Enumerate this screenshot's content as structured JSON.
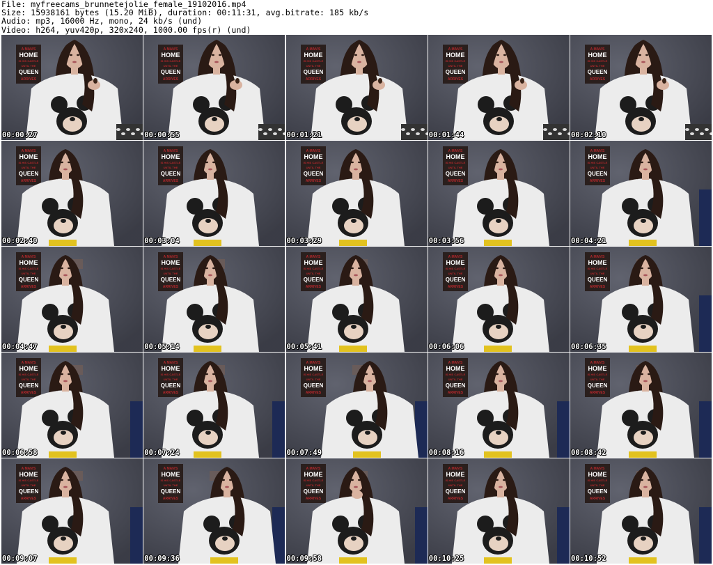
{
  "header": {
    "lines": [
      "File: myfreecams_brunnetejolie_female_19102016.mp4",
      "Size: 15938161 bytes (15.20 MiB), duration: 00:11:31, avg.bitrate: 185 kb/s",
      "Audio: mp3, 16000 Hz, mono, 24 kb/s (und)",
      "Video: h264, yuv420p, 320x240, 1000.00 fps(r) (und)"
    ]
  },
  "thumbnails": [
    {
      "timestamp": "00:00:27",
      "framing": "close",
      "pose": "holding-item"
    },
    {
      "timestamp": "00:00:55",
      "framing": "close",
      "pose": "holding-item"
    },
    {
      "timestamp": "00:01:21",
      "framing": "close",
      "pose": "holding-item"
    },
    {
      "timestamp": "00:01:44",
      "framing": "close",
      "pose": "holding-item"
    },
    {
      "timestamp": "00:02:10",
      "framing": "close",
      "pose": "holding-item"
    },
    {
      "timestamp": "00:02:40",
      "framing": "mid",
      "pose": "seated"
    },
    {
      "timestamp": "00:03:04",
      "framing": "mid",
      "pose": "seated"
    },
    {
      "timestamp": "00:03:29",
      "framing": "mid",
      "pose": "seated"
    },
    {
      "timestamp": "00:03:56",
      "framing": "mid",
      "pose": "seated"
    },
    {
      "timestamp": "00:04:21",
      "framing": "mid",
      "pose": "seated"
    },
    {
      "timestamp": "00:04:47",
      "framing": "mid",
      "pose": "seated"
    },
    {
      "timestamp": "00:05:14",
      "framing": "mid",
      "pose": "seated"
    },
    {
      "timestamp": "00:05:41",
      "framing": "mid",
      "pose": "seated"
    },
    {
      "timestamp": "00:06:06",
      "framing": "mid",
      "pose": "seated"
    },
    {
      "timestamp": "00:06:35",
      "framing": "mid",
      "pose": "seated"
    },
    {
      "timestamp": "00:06:58",
      "framing": "mid",
      "pose": "seated"
    },
    {
      "timestamp": "00:07:24",
      "framing": "mid",
      "pose": "seated"
    },
    {
      "timestamp": "00:07:49",
      "framing": "mid",
      "pose": "leaning"
    },
    {
      "timestamp": "00:08:16",
      "framing": "mid",
      "pose": "seated"
    },
    {
      "timestamp": "00:08:42",
      "framing": "mid",
      "pose": "seated"
    },
    {
      "timestamp": "00:09:07",
      "framing": "mid",
      "pose": "seated"
    },
    {
      "timestamp": "00:09:36",
      "framing": "mid",
      "pose": "leaning"
    },
    {
      "timestamp": "00:09:58",
      "framing": "mid",
      "pose": "hand-on-chin"
    },
    {
      "timestamp": "00:10:25",
      "framing": "mid",
      "pose": "seated"
    },
    {
      "timestamp": "00:10:52",
      "framing": "mid",
      "pose": "seated"
    }
  ],
  "poster": {
    "lines": [
      "A MAN'S",
      "HOME",
      "IS HIS CASTLE",
      "UNTIL THE",
      "QUEEN",
      "ARRIVES"
    ]
  },
  "colors": {
    "wall": "#4a4c57",
    "sweater": "#ececec",
    "hair": "#2a1a14",
    "skin": "#d9b3a0",
    "mouse_black": "#1c1c1c",
    "shorts_yellow": "#e2c21f",
    "poster_bg": "#2a1f1d",
    "poster_red": "#b0282c",
    "chair_blue": "#1d2a55"
  }
}
